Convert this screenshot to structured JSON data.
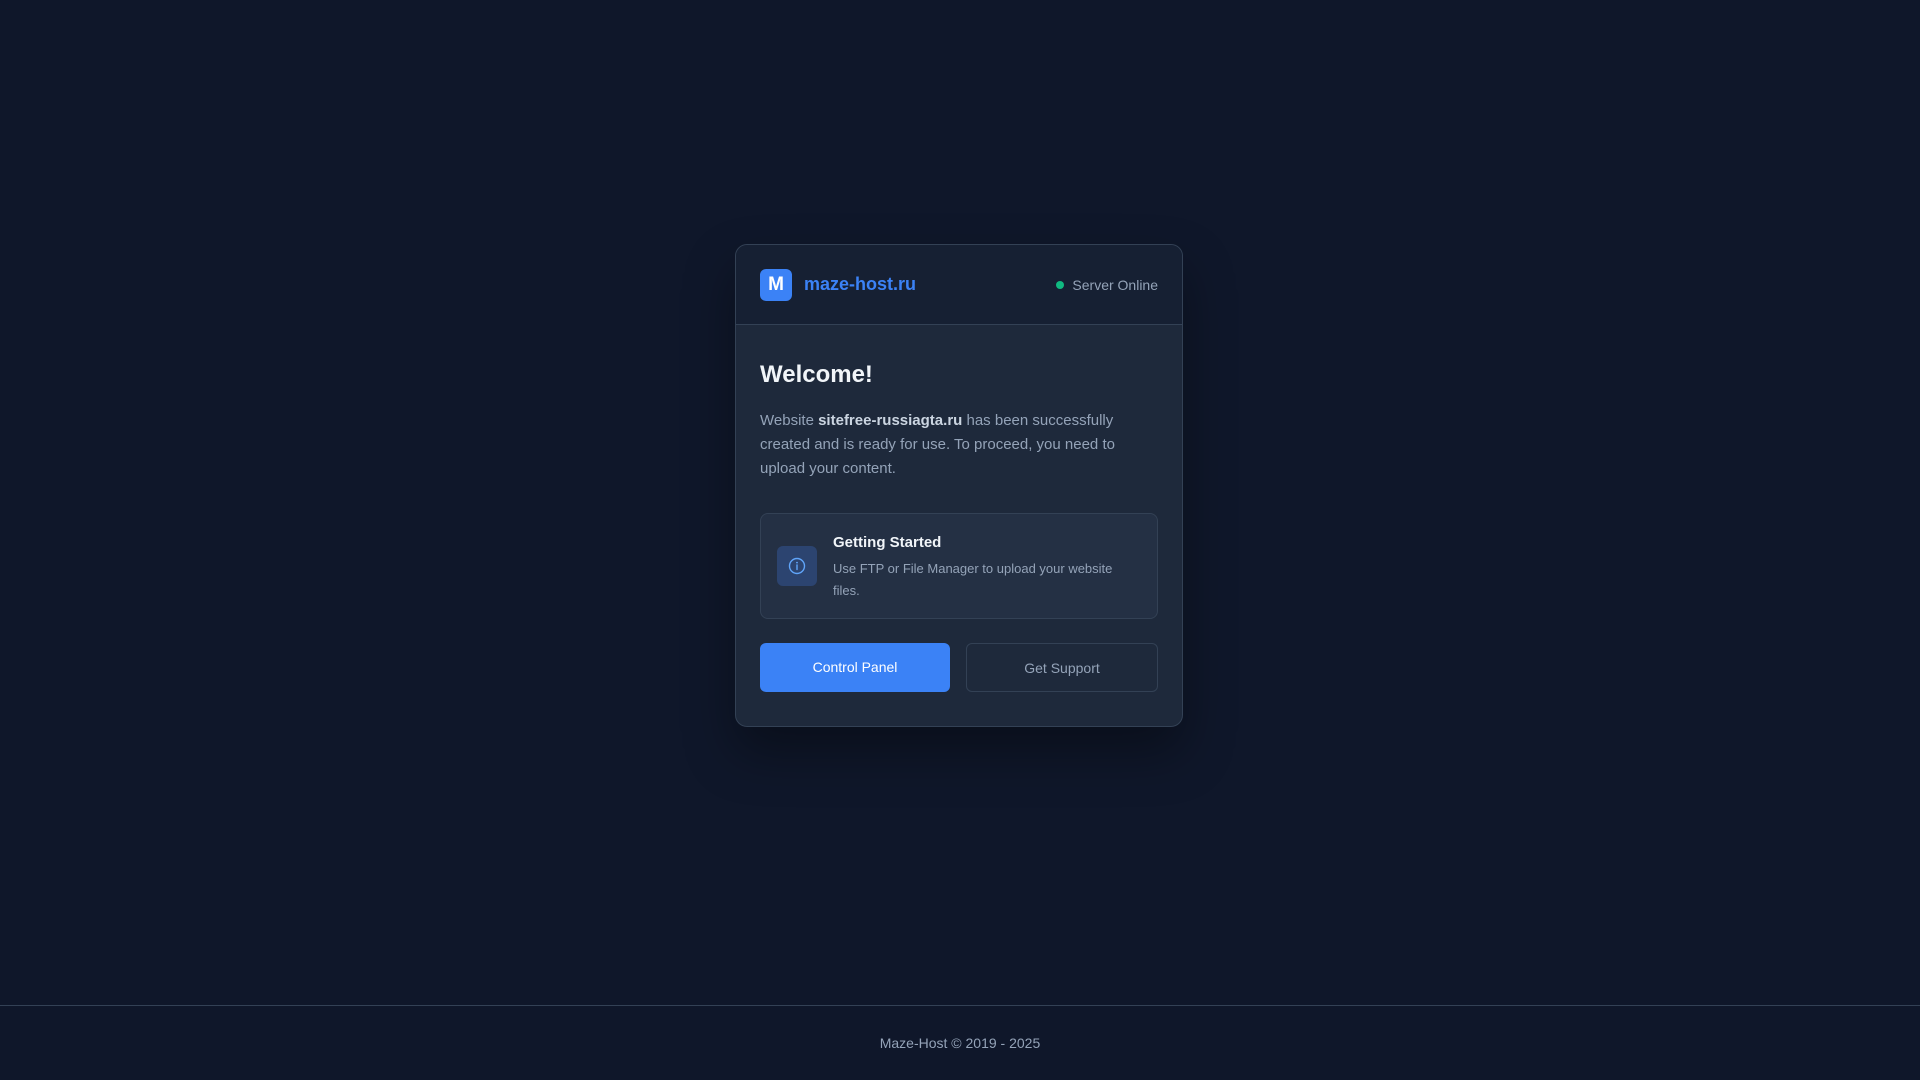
{
  "colors": {
    "background": "#0f172a",
    "card": "#1e293b",
    "accent": "#3b82f6",
    "status_online": "#10b981",
    "muted_text": "#94a3b8"
  },
  "header": {
    "logo_letter": "M",
    "brand_name": "maze-host.ru",
    "status_text": "Server Online"
  },
  "main": {
    "title": "Welcome!",
    "description_prefix": "Website ",
    "site_name": "sitefree-russiagta.ru",
    "description_suffix": " has been successfully created and is ready for use. To proceed, you need to upload your content."
  },
  "info_box": {
    "icon": "info-icon",
    "title": "Getting Started",
    "text": "Use FTP or File Manager to upload your website files."
  },
  "actions": {
    "primary_label": "Control Panel",
    "secondary_label": "Get Support"
  },
  "footer": {
    "text": "Maze-Host © 2019 - 2025"
  }
}
